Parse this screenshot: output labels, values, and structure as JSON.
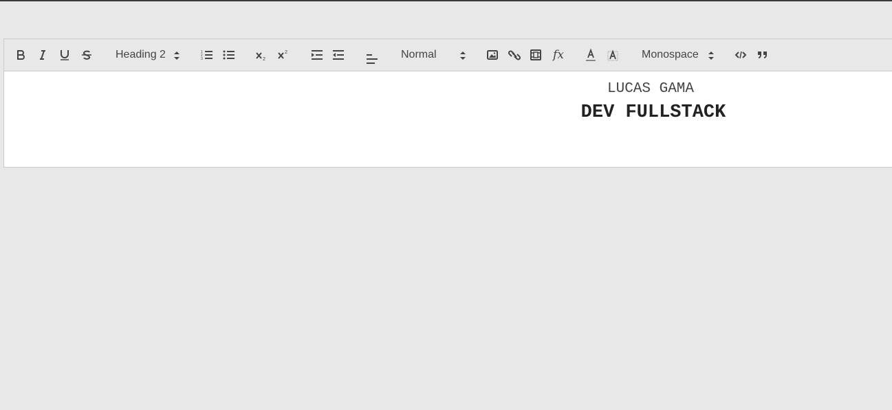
{
  "toolbar": {
    "bold_icon": "bold-icon",
    "italic_icon": "italic-icon",
    "underline_icon": "underline-icon",
    "strike_icon": "strikethrough-icon",
    "header_picker_value": "Heading 2",
    "ordered_list_icon": "ordered-list-icon",
    "bullet_list_icon": "bullet-list-icon",
    "subscript_icon": "subscript-icon",
    "superscript_icon": "superscript-icon",
    "indent_icon": "indent-icon",
    "outdent_icon": "outdent-icon",
    "align_icon": "align-left-icon",
    "size_picker_value": "Normal",
    "image_icon": "image-icon",
    "link_icon": "link-icon",
    "video_icon": "video-icon",
    "formula_icon": "formula-icon",
    "formula_glyph": "fx",
    "color_icon": "text-color-icon",
    "background_icon": "background-color-icon",
    "font_picker_value": "Monospace",
    "code_block_icon": "code-icon",
    "blockquote_icon": "blockquote-icon"
  },
  "content": {
    "line1": "LUCAS GAMA",
    "line2": "DEV FULLSTACK"
  },
  "colors": {
    "page_bg": "#e8e8e8",
    "editor_bg": "#ffffff",
    "icon": "#444444",
    "border": "#cccccc"
  }
}
